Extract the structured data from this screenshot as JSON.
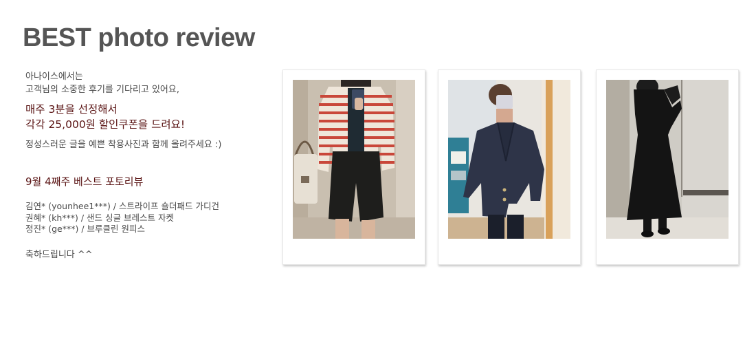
{
  "header": {
    "title": "BEST photo review"
  },
  "intro": {
    "line1": "아나이스에서는",
    "line2": "고객님의 소중한 후기를 기다리고 있어요,",
    "highlight1": "매주 3분을 선정해서",
    "highlight2": "각각 25,000원 할인쿠폰을 드려요!",
    "note": "정성스러운 글을 예쁜 착용사진과 함께 올려주세요 :)"
  },
  "week_title": "9월 4째주 베스트 포토리뷰",
  "winners": [
    "김연* (younhee1***) /  스트라이프 숄더패드 가디건",
    "권혜* (kh***) / 샌드 싱글 브레스트 자켓",
    "정진* (ge***) /  브루클린 원피스"
  ],
  "congrats": "축하드립니다 ^^",
  "photos": [
    {
      "alt": "striped cardigan review photo"
    },
    {
      "alt": "navy jacket review photo"
    },
    {
      "alt": "black dress review photo"
    }
  ],
  "colors": {
    "title": "#555555",
    "highlight": "#5a1414",
    "body": "#4a4a4a"
  }
}
